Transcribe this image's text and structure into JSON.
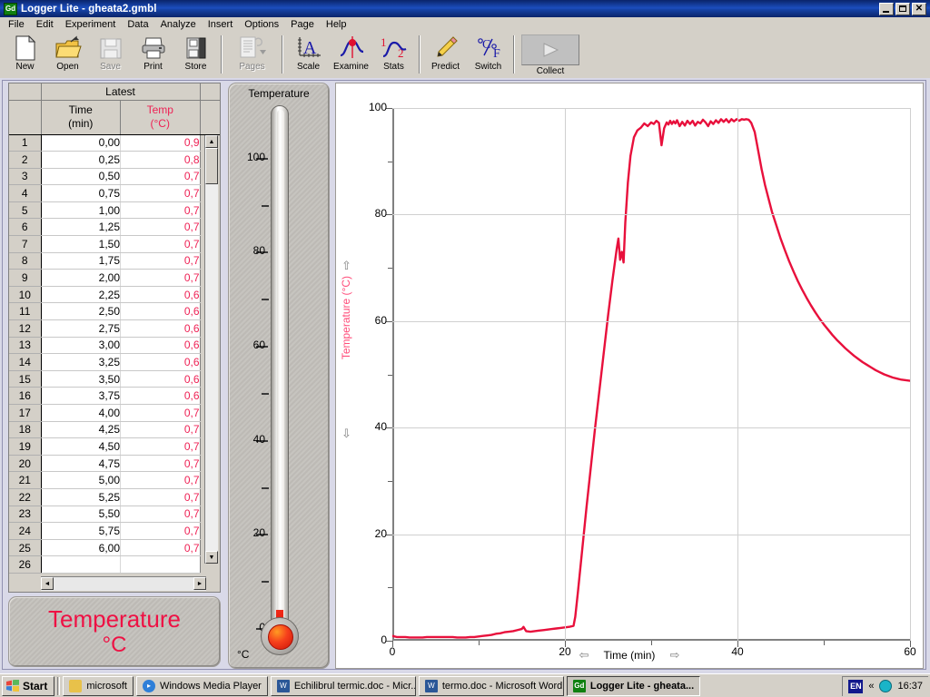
{
  "window": {
    "title": "Logger Lite - gheata2.gmbl",
    "icon": "logger-lite-icon",
    "icon_text": "Gd",
    "minimize": "_",
    "maximize": "□",
    "close": "✕"
  },
  "menu": [
    "File",
    "Edit",
    "Experiment",
    "Data",
    "Analyze",
    "Insert",
    "Options",
    "Page",
    "Help"
  ],
  "toolbar": [
    {
      "label": "New",
      "icon": "new-document-icon",
      "disabled": false
    },
    {
      "label": "Open",
      "icon": "open-folder-icon",
      "disabled": false
    },
    {
      "label": "Save",
      "icon": "floppy-disk-icon",
      "disabled": true
    },
    {
      "label": "Print",
      "icon": "printer-icon",
      "disabled": false
    },
    {
      "label": "Store",
      "icon": "store-data-icon",
      "disabled": false
    },
    {
      "label": "Pages",
      "icon": "pages-icon",
      "disabled": true
    },
    {
      "label": "Scale",
      "icon": "autoscale-icon",
      "disabled": false
    },
    {
      "label": "Examine",
      "icon": "examine-icon",
      "disabled": false
    },
    {
      "label": "Stats",
      "icon": "statistics-icon",
      "disabled": false
    },
    {
      "label": "Predict",
      "icon": "predict-pencil-icon",
      "disabled": false
    },
    {
      "label": "Switch",
      "icon": "switch-units-icon",
      "disabled": false
    },
    {
      "label": "Collect",
      "icon": "collect-play-icon",
      "disabled": false
    }
  ],
  "table": {
    "group_header": "Latest",
    "columns": [
      {
        "name": "Time",
        "unit": "(min)",
        "color": "#000000"
      },
      {
        "name": "Temp",
        "unit": "(°C)",
        "color": "#ee2255"
      }
    ],
    "rows": [
      {
        "n": "1",
        "time": "0,00",
        "temp": "0,9"
      },
      {
        "n": "2",
        "time": "0,25",
        "temp": "0,8"
      },
      {
        "n": "3",
        "time": "0,50",
        "temp": "0,7"
      },
      {
        "n": "4",
        "time": "0,75",
        "temp": "0,7"
      },
      {
        "n": "5",
        "time": "1,00",
        "temp": "0,7"
      },
      {
        "n": "6",
        "time": "1,25",
        "temp": "0,7"
      },
      {
        "n": "7",
        "time": "1,50",
        "temp": "0,7"
      },
      {
        "n": "8",
        "time": "1,75",
        "temp": "0,7"
      },
      {
        "n": "9",
        "time": "2,00",
        "temp": "0,7"
      },
      {
        "n": "10",
        "time": "2,25",
        "temp": "0,6"
      },
      {
        "n": "11",
        "time": "2,50",
        "temp": "0,6"
      },
      {
        "n": "12",
        "time": "2,75",
        "temp": "0,6"
      },
      {
        "n": "13",
        "time": "3,00",
        "temp": "0,6"
      },
      {
        "n": "14",
        "time": "3,25",
        "temp": "0,6"
      },
      {
        "n": "15",
        "time": "3,50",
        "temp": "0,6"
      },
      {
        "n": "16",
        "time": "3,75",
        "temp": "0,6"
      },
      {
        "n": "17",
        "time": "4,00",
        "temp": "0,7"
      },
      {
        "n": "18",
        "time": "4,25",
        "temp": "0,7"
      },
      {
        "n": "19",
        "time": "4,50",
        "temp": "0,7"
      },
      {
        "n": "20",
        "time": "4,75",
        "temp": "0,7"
      },
      {
        "n": "21",
        "time": "5,00",
        "temp": "0,7"
      },
      {
        "n": "22",
        "time": "5,25",
        "temp": "0,7"
      },
      {
        "n": "23",
        "time": "5,50",
        "temp": "0,7"
      },
      {
        "n": "24",
        "time": "5,75",
        "temp": "0,7"
      },
      {
        "n": "25",
        "time": "6,00",
        "temp": "0,7"
      },
      {
        "n": "26",
        "time": "",
        "temp": ""
      }
    ]
  },
  "meter": {
    "title": "Temperature",
    "unit": "°C",
    "min": 0,
    "max": 110,
    "value": 0.7,
    "major_ticks": [
      0,
      20,
      40,
      60,
      80,
      100
    ],
    "minor_ticks": [
      10,
      30,
      50,
      70,
      90
    ],
    "fluid_color": "#ee2211"
  },
  "title_box": {
    "line1": "Temperature",
    "line2": "°C",
    "color": "#ee1144"
  },
  "chart_data": {
    "type": "line",
    "title": "",
    "xlabel": "Time (min)",
    "ylabel": "Temperature (°C)",
    "xlim": [
      0,
      60
    ],
    "ylim": [
      0,
      100
    ],
    "x_major_ticks": [
      0,
      20,
      40,
      60
    ],
    "x_minor_ticks": [
      10,
      30,
      50
    ],
    "y_major_ticks": [
      0,
      20,
      40,
      60,
      80,
      100
    ],
    "y_minor_ticks": [
      10,
      30,
      50,
      70,
      90
    ],
    "grid": true,
    "legend": "none",
    "series": [
      {
        "name": "Temperature (°C)",
        "color": "#e8103c",
        "x": [
          0,
          0.5,
          1,
          1.5,
          2,
          2.5,
          3,
          3.5,
          4,
          4.5,
          5,
          5.5,
          6,
          6.5,
          7,
          7.5,
          8,
          8.5,
          9,
          9.5,
          10,
          10.5,
          11,
          11.5,
          12,
          12.5,
          13,
          13.5,
          14,
          14.5,
          15,
          15.2,
          15.5,
          16,
          16.5,
          17,
          17.5,
          18,
          18.5,
          19,
          19.5,
          20,
          20.5,
          21,
          21.2,
          21.5,
          22,
          22.5,
          23,
          23.5,
          24,
          24.5,
          25,
          25.5,
          26,
          26.2,
          26.4,
          26.6,
          26.8,
          27,
          27.3,
          27.6,
          28,
          28.4,
          28.8,
          29.2,
          29.6,
          30,
          30.3,
          30.6,
          30.9,
          31.2,
          31.5,
          31.8,
          32,
          32.2,
          32.4,
          32.6,
          32.8,
          33,
          33.3,
          33.6,
          33.9,
          34.2,
          34.5,
          34.8,
          35.1,
          35.4,
          35.7,
          36,
          36.3,
          36.6,
          36.9,
          37.2,
          37.5,
          37.8,
          38.1,
          38.4,
          38.7,
          39,
          39.3,
          39.6,
          39.9,
          40.2,
          40.5,
          40.8,
          41,
          41.3,
          41.6,
          42,
          42.4,
          42.8,
          43.2,
          43.6,
          44,
          44.5,
          45,
          45.5,
          46,
          46.5,
          47,
          47.5,
          48,
          48.5,
          49,
          49.5,
          50,
          50.5,
          51,
          51.5,
          52,
          52.5,
          53,
          53.5,
          54,
          54.5,
          55,
          55.5,
          56,
          56.5,
          57,
          57.5,
          58,
          58.5,
          59,
          59.5,
          60
        ],
        "y": [
          0.9,
          0.7,
          0.7,
          0.7,
          0.6,
          0.6,
          0.6,
          0.6,
          0.7,
          0.7,
          0.7,
          0.7,
          0.7,
          0.7,
          0.7,
          0.6,
          0.6,
          0.6,
          0.7,
          0.7,
          0.8,
          0.9,
          1.0,
          1.1,
          1.3,
          1.4,
          1.6,
          1.7,
          1.8,
          2.0,
          2.2,
          2.6,
          1.8,
          1.7,
          1.8,
          1.9,
          2.0,
          2.1,
          2.2,
          2.3,
          2.4,
          2.5,
          2.6,
          2.8,
          4.5,
          9.0,
          17.0,
          25.0,
          32.5,
          40.0,
          47.0,
          54.0,
          61.0,
          67.5,
          73.5,
          75.5,
          71.5,
          73.0,
          71.0,
          78.5,
          86.0,
          91.0,
          94.5,
          95.8,
          96.3,
          97.1,
          96.6,
          97.3,
          97.0,
          97.6,
          97.2,
          93.0,
          96.2,
          97.3,
          96.9,
          97.6,
          97.0,
          97.5,
          97.1,
          97.7,
          96.6,
          97.4,
          96.7,
          97.6,
          97.0,
          97.6,
          96.7,
          97.4,
          97.1,
          97.8,
          97.3,
          96.6,
          97.5,
          97.0,
          97.7,
          97.2,
          97.9,
          97.4,
          97.9,
          97.3,
          97.9,
          97.5,
          97.9,
          97.6,
          97.9,
          97.8,
          97.9,
          97.8,
          97.2,
          95.5,
          92.0,
          88.5,
          85.5,
          83.0,
          80.5,
          78.0,
          75.5,
          73.3,
          71.2,
          69.3,
          67.5,
          65.9,
          64.4,
          63.0,
          61.7,
          60.5,
          59.4,
          58.4,
          57.4,
          56.5,
          55.7,
          54.9,
          54.2,
          53.5,
          52.9,
          52.3,
          51.8,
          51.3,
          50.8,
          50.4,
          50.0,
          49.7,
          49.4,
          49.2,
          49.0,
          48.9,
          48.8
        ]
      }
    ]
  },
  "graph": {
    "y_axis_up_arrow": "⇧",
    "y_axis_down_arrow": "⇩",
    "x_axis_left_arrow": "⇦",
    "x_axis_right_arrow": "⇨"
  },
  "taskbar": {
    "start_label": "Start",
    "buttons": [
      {
        "label": "microsoft",
        "icon": "folder-icon",
        "active": false,
        "color": "#e8c14a"
      },
      {
        "label": "Windows Media Player",
        "icon": "media-player-icon",
        "active": false,
        "color": "#2f7fd8"
      },
      {
        "label": "Echilibrul termic.doc - Micr...",
        "icon": "word-doc-icon",
        "active": false,
        "color": "#2b5797"
      },
      {
        "label": "termo.doc - Microsoft Word",
        "icon": "word-doc-icon",
        "active": false,
        "color": "#2b5797"
      },
      {
        "label": "Logger Lite - gheata...",
        "icon": "logger-lite-icon",
        "active": true,
        "color": "#108010"
      }
    ],
    "tray": {
      "language": "EN",
      "chevron": "«",
      "cd_icon": "cd-drive-icon",
      "clock": "16:37"
    }
  }
}
